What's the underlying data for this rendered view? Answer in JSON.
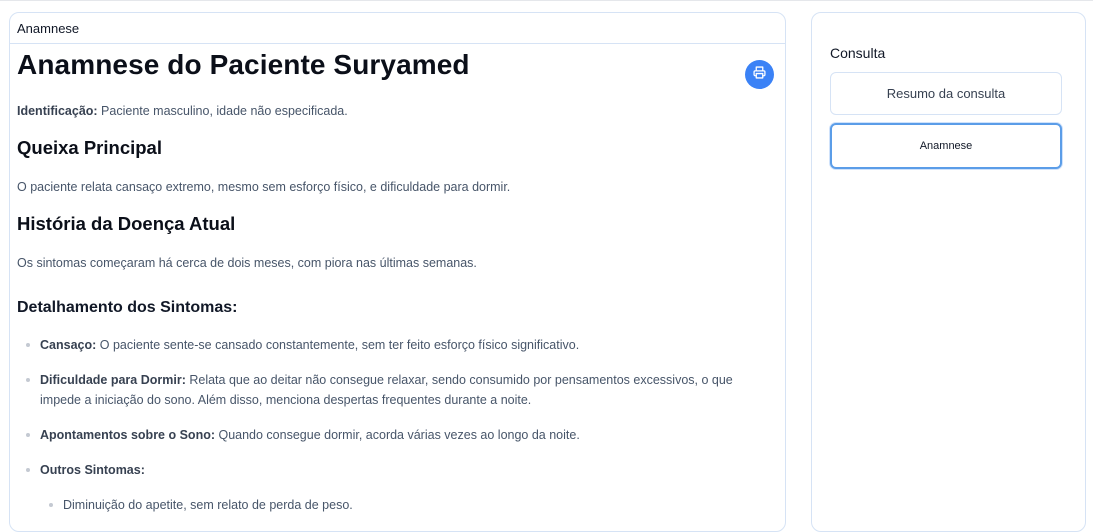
{
  "main": {
    "header_label": "Anamnese",
    "title": "Anamnese do Paciente Suryamed",
    "print_icon": "printer-icon",
    "identification_label": "Identificação:",
    "identification_text": " Paciente masculino, idade não especificada.",
    "section_complaint_title": "Queixa Principal",
    "section_complaint_text": "O paciente relata cansaço extremo, mesmo sem esforço físico, e dificuldade para dormir.",
    "section_history_title": "História da Doença Atual",
    "section_history_text": "Os sintomas começaram há cerca de dois meses, com piora nas últimas semanas.",
    "symptoms_title": "Detalhamento dos Sintomas:",
    "symptoms": [
      {
        "label": "Cansaço:",
        "text": " O paciente sente-se cansado constantemente, sem ter feito esforço físico significativo."
      },
      {
        "label": "Dificuldade para Dormir:",
        "text": " Relata que ao deitar não consegue relaxar, sendo consumido por pensamentos excessivos, o que impede a iniciação do sono. Além disso, menciona despertas frequentes durante a noite."
      },
      {
        "label": "Apontamentos sobre o Sono:",
        "text": " Quando consegue dormir, acorda várias vezes ao longo da noite."
      },
      {
        "label": "Outros Sintomas:",
        "text": ""
      }
    ],
    "sub_symptoms": [
      "Diminuição do apetite, sem relato de perda de peso."
    ]
  },
  "sidebar": {
    "title": "Consulta",
    "button_summary": "Resumo da consulta",
    "button_anamnese": "Anamnese"
  },
  "colors": {
    "accent": "#3b82f6",
    "border": "#d6e3f5"
  }
}
